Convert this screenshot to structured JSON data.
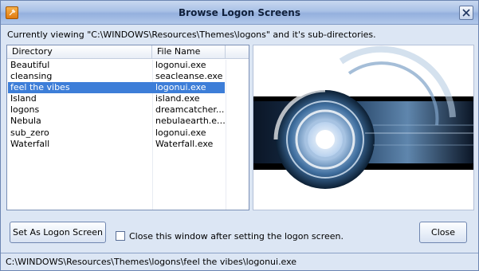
{
  "window": {
    "title": "Browse Logon Screens",
    "accent": "#3d7ed8"
  },
  "info": {
    "text": "Currently viewing \"C:\\WINDOWS\\Resources\\Themes\\logons\" and it's sub-directories."
  },
  "list": {
    "columns": [
      "Directory",
      "File Name"
    ],
    "rows": [
      {
        "directory": "Beautiful",
        "file": "logonui.exe"
      },
      {
        "directory": "cleansing",
        "file": "seacleanse.exe"
      },
      {
        "directory": "feel the vibes",
        "file": "logonui.exe"
      },
      {
        "directory": "Island",
        "file": "island.exe"
      },
      {
        "directory": "logons",
        "file": "dreamcatcher..."
      },
      {
        "directory": "Nebula",
        "file": "nebulaearth.exe"
      },
      {
        "directory": "sub_zero",
        "file": "logonui.exe"
      },
      {
        "directory": "Waterfall",
        "file": "Waterfall.exe"
      }
    ],
    "selected_index": 2
  },
  "buttons": {
    "set_label": "Set As Logon Screen",
    "close_label": "Close"
  },
  "options": {
    "close_after_label": "Close this window after setting the logon screen.",
    "close_after_checked": false
  },
  "status": {
    "path": "C:\\WINDOWS\\Resources\\Themes\\logons\\feel the vibes\\logonui.exe"
  }
}
